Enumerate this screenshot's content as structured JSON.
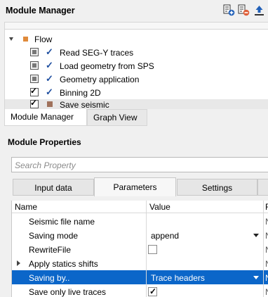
{
  "module_manager": {
    "title": "Module Manager",
    "toolbar": [
      {
        "name": "add-module-icon"
      },
      {
        "name": "remove-module-icon"
      },
      {
        "name": "export-icon"
      }
    ],
    "flow": {
      "label": "Flow",
      "modules": [
        {
          "label": "Read SEG-Y traces",
          "state": "disabled-checked"
        },
        {
          "label": "Load geometry from SPS",
          "state": "disabled-checked"
        },
        {
          "label": "Geometry application",
          "state": "disabled-checked"
        },
        {
          "label": "Binning 2D",
          "state": "enabled-checked"
        },
        {
          "label": "Save seismic",
          "state": "enabled-selected"
        }
      ]
    },
    "tabs": [
      {
        "label": "Module Manager",
        "active": true
      },
      {
        "label": "Graph View",
        "active": false
      }
    ]
  },
  "module_properties": {
    "title": "Module Properties",
    "search_placeholder": "Search Property",
    "tabs": [
      {
        "label": "Input data",
        "active": false
      },
      {
        "label": "Parameters",
        "active": true
      },
      {
        "label": "Settings",
        "active": false
      }
    ],
    "columns": [
      "Name",
      "Value",
      "F"
    ],
    "rows": [
      {
        "name": "Seismic file name",
        "value": "",
        "third": "N"
      },
      {
        "name": "Saving mode",
        "value": "append",
        "third": "N"
      },
      {
        "name": "RewriteFile",
        "value": "",
        "third": "N"
      },
      {
        "name": "Apply statics shifts",
        "value": "",
        "third": "N"
      },
      {
        "name": "Saving by..",
        "value": "Trace headers",
        "third": "N"
      },
      {
        "name": "Save only live traces",
        "value": "",
        "third": "N"
      }
    ]
  },
  "colors": {
    "flow_icon": "#e08a3a",
    "save_icon": "#a0725c",
    "check_blue": "#1f4fa0",
    "selection": "#0b66c9"
  }
}
